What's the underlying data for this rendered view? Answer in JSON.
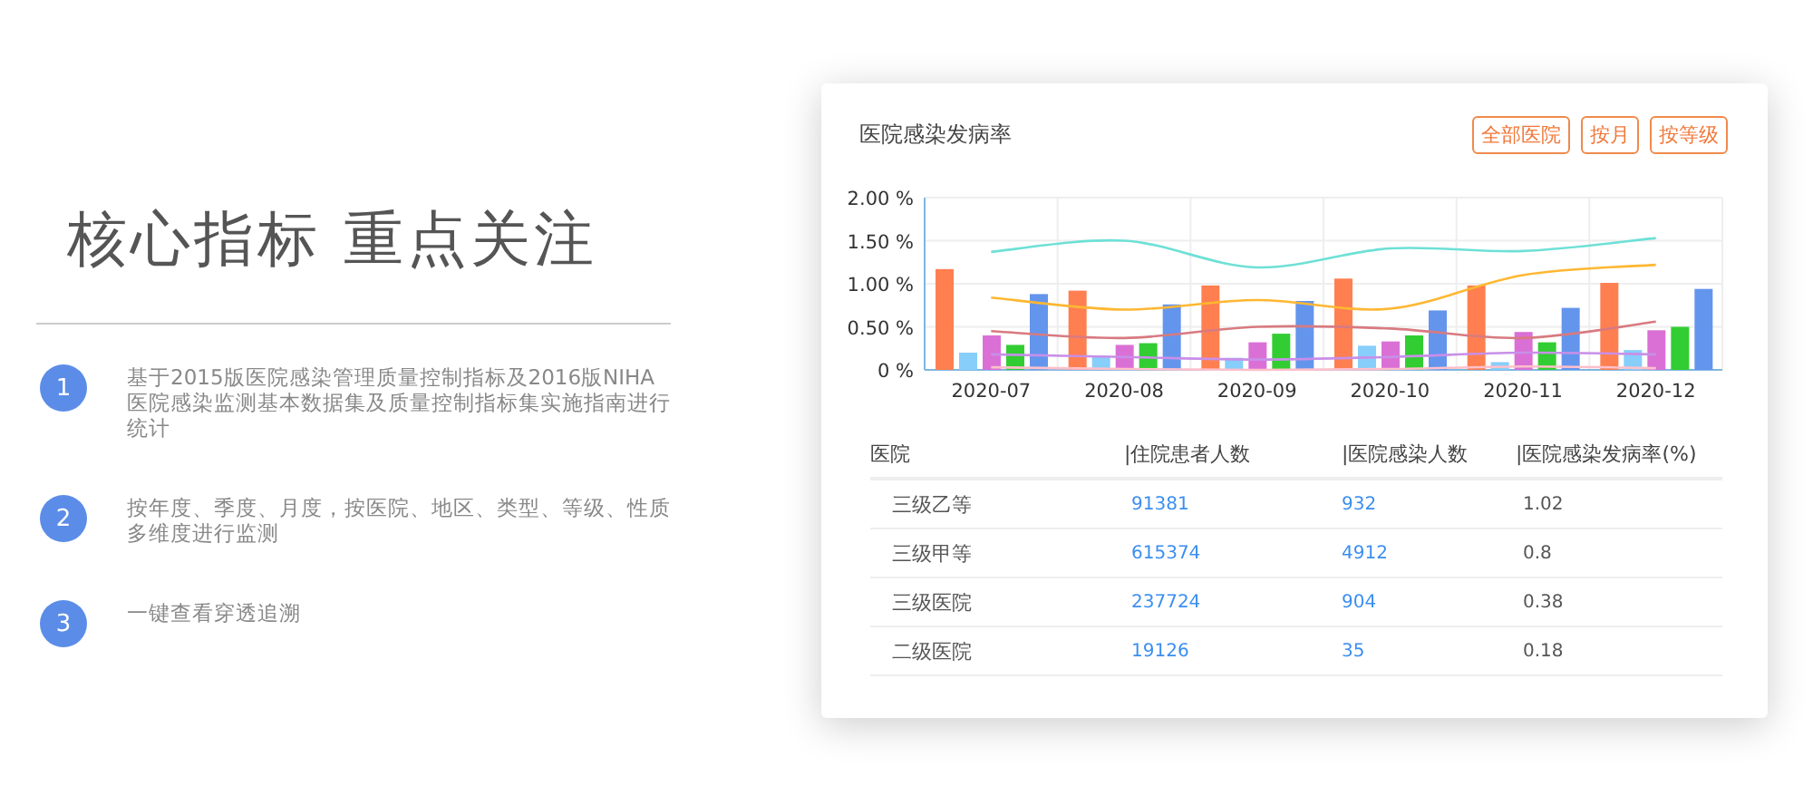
{
  "headline": "核心指标 重点关注",
  "features": [
    {
      "number": "1",
      "text": "基于2015版医院感染管理质量控制指标及2016版NIHA医院感染监测基本数据集及质量控制指标集实施指南进行统计"
    },
    {
      "number": "2",
      "text": "按年度、季度、月度，按医院、地区、类型、等级、性质多维度进行监测"
    },
    {
      "number": "3",
      "text": "一键查看穿透追溯"
    }
  ],
  "card": {
    "title": "医院感染发病率",
    "filters": [
      "全部医院",
      "按月",
      "按等级"
    ],
    "chart_data": {
      "type": "bar",
      "grid": true,
      "categories": [
        "2020-07",
        "2020-08",
        "2020-09",
        "2020-10",
        "2020-11",
        "2020-12"
      ],
      "ylim": [
        0,
        2
      ],
      "yticks": [
        {
          "value": 0,
          "label": "0 %"
        },
        {
          "value": 0.5,
          "label": "0.50 %"
        },
        {
          "value": 1,
          "label": "1.00 %"
        },
        {
          "value": 1.5,
          "label": "1.50 %"
        },
        {
          "value": 2,
          "label": "2.00 %"
        }
      ],
      "series": [
        {
          "color": "#ff7f50",
          "values": [
            1.17,
            0.92,
            0.98,
            1.06,
            0.98,
            1.01
          ]
        },
        {
          "color": "#87cefa",
          "values": [
            0.2,
            0.16,
            0.14,
            0.28,
            0.09,
            0.23
          ]
        },
        {
          "color": "#da70d6",
          "values": [
            0.4,
            0.29,
            0.32,
            0.33,
            0.44,
            0.46
          ]
        },
        {
          "color": "#32cd32",
          "values": [
            0.29,
            0.31,
            0.42,
            0.4,
            0.32,
            0.5
          ]
        },
        {
          "color": "#6495ed",
          "values": [
            0.88,
            0.76,
            0.8,
            0.69,
            0.72,
            0.94
          ]
        },
        {
          "type": "line",
          "color": "#6ee0d6",
          "values": [
            1.37,
            1.5,
            1.19,
            1.41,
            1.38,
            1.53
          ]
        },
        {
          "type": "line",
          "color": "#ffb732",
          "values": [
            0.84,
            0.7,
            0.81,
            0.71,
            1.1,
            1.22
          ]
        },
        {
          "type": "line",
          "color": "#d87a80",
          "values": [
            0.45,
            0.37,
            0.5,
            0.48,
            0.37,
            0.56
          ]
        },
        {
          "type": "line",
          "color": "#c88fe8",
          "values": [
            0.18,
            0.15,
            0.12,
            0.15,
            0.2,
            0.18
          ]
        },
        {
          "type": "line",
          "color": "#ffc0cb",
          "values": [
            0.03,
            0.01,
            0.0,
            0.01,
            0.04,
            0.02
          ]
        }
      ]
    },
    "table": {
      "columns": [
        "医院",
        "|住院患者人数",
        "|医院感染人数",
        "|医院感染发病率(%)"
      ],
      "rows": [
        [
          "三级乙等",
          "91381",
          "932",
          "1.02"
        ],
        [
          "三级甲等",
          "615374",
          "4912",
          "0.8"
        ],
        [
          "三级医院",
          "237724",
          "904",
          "0.38"
        ],
        [
          "二级医院",
          "19126",
          "35",
          "0.18"
        ]
      ]
    }
  }
}
